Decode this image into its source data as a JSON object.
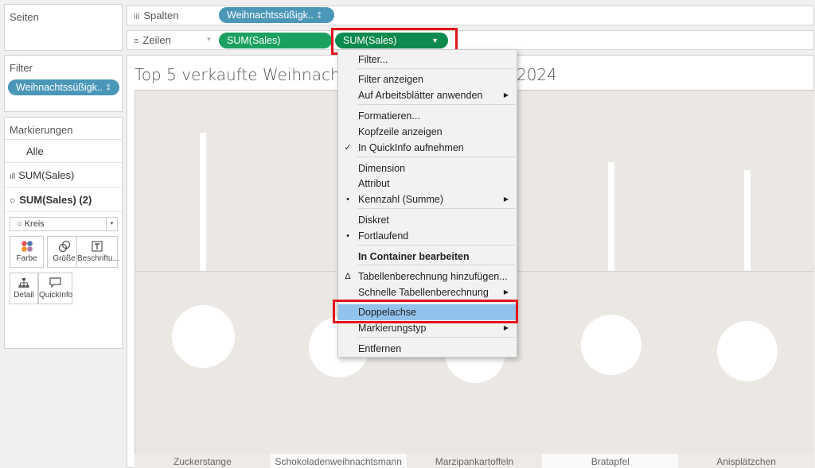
{
  "left": {
    "pages_title": "Seiten",
    "filter_title": "Filter",
    "filter_pill": "Weihnachtssüßigk..",
    "marks_title": "Markierungen",
    "marks_all": "Alle",
    "marks_sum1": "SUM(Sales)",
    "marks_sum2": "SUM(Sales) (2)",
    "mark_type": "Kreis",
    "btn_color": "Farbe",
    "btn_size": "Größe",
    "btn_label": "Beschriftu...",
    "btn_detail": "Detail",
    "btn_tooltip": "QuickInfo"
  },
  "shelves": {
    "columns_label": "Spalten",
    "columns_pill": "Weihnachtssüßigk..",
    "rows_label": "Zeilen",
    "rows_pill1": "SUM(Sales)",
    "rows_pill2": "SUM(Sales)"
  },
  "viz": {
    "title_left": "Top 5 verkaufte Weihnachts",
    "title_right": "2024"
  },
  "chart_data": {
    "type": "bar",
    "title": "Top 5 verkaufte Weihnachts… 2024",
    "categories": [
      "Zuckerstange",
      "Schokoladenweihnachtsmann",
      "Marzipankartoffeln",
      "Bratapfel",
      "Anisplätzchen"
    ],
    "bar_heights_ratio": [
      1.0,
      0.0,
      0.0,
      0.79,
      0.73
    ],
    "circle_ratio": [
      0.86,
      0.52,
      0.36,
      0.59,
      0.4
    ]
  },
  "menu": {
    "items": [
      {
        "label": "Filter...",
        "mark": "",
        "sub": false,
        "bold": false
      },
      {
        "label": "Filter anzeigen",
        "mark": "",
        "sub": false,
        "bold": false
      },
      {
        "label": "Auf Arbeitsblätter anwenden",
        "mark": "",
        "sub": true,
        "bold": false
      },
      {
        "label": "Formatieren...",
        "mark": "",
        "sub": false,
        "bold": false
      },
      {
        "label": "Kopfzeile anzeigen",
        "mark": "",
        "sub": false,
        "bold": false
      },
      {
        "label": "In QuickInfo aufnehmen",
        "mark": "✓",
        "sub": false,
        "bold": false
      },
      {
        "label": "Dimension",
        "mark": "",
        "sub": false,
        "bold": false
      },
      {
        "label": "Attribut",
        "mark": "",
        "sub": false,
        "bold": false
      },
      {
        "label": "Kennzahl (Summe)",
        "mark": "•",
        "sub": true,
        "bold": false
      },
      {
        "label": "Diskret",
        "mark": "",
        "sub": false,
        "bold": false
      },
      {
        "label": "Fortlaufend",
        "mark": "•",
        "sub": false,
        "bold": false
      },
      {
        "label": "In Container bearbeiten",
        "mark": "",
        "sub": false,
        "bold": true
      },
      {
        "label": "Tabellenberechnung hinzufügen...",
        "mark": "Δ",
        "sub": false,
        "bold": false
      },
      {
        "label": "Schnelle Tabellenberechnung",
        "mark": "",
        "sub": true,
        "bold": false
      },
      {
        "label": "Doppelachse",
        "mark": "",
        "sub": false,
        "bold": false,
        "highlighted": true
      },
      {
        "label": "Markierungstyp",
        "mark": "",
        "sub": true,
        "bold": false
      },
      {
        "label": "Entfernen",
        "mark": "",
        "sub": false,
        "bold": false
      }
    ]
  },
  "colors": {
    "pill_blue": "#4a97b8",
    "pill_green": "#1aa15f",
    "highlight": "#92c3ec",
    "callout_red": "#e3141b"
  }
}
